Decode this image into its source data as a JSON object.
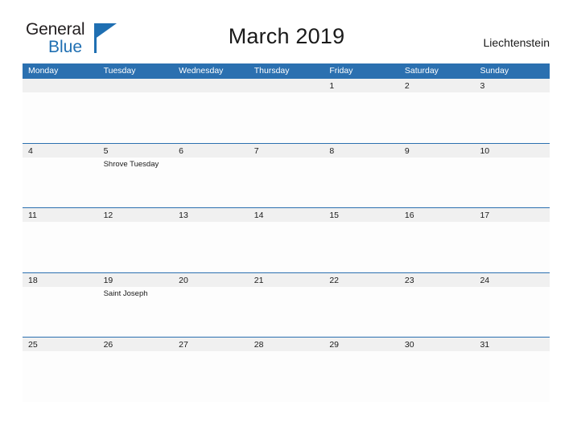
{
  "brand": {
    "name_part1": "General",
    "name_part2": "Blue",
    "triangle_icon": "triangle-icon",
    "accent_color": "#1f6fb2"
  },
  "header": {
    "title": "March 2019",
    "region": "Liechtenstein"
  },
  "calendar": {
    "header_bg": "#2b70b0",
    "band_bg": "#f0f0f0",
    "weekdays": [
      "Monday",
      "Tuesday",
      "Wednesday",
      "Thursday",
      "Friday",
      "Saturday",
      "Sunday"
    ],
    "weeks": [
      [
        {
          "num": "",
          "event": ""
        },
        {
          "num": "",
          "event": ""
        },
        {
          "num": "",
          "event": ""
        },
        {
          "num": "",
          "event": ""
        },
        {
          "num": "1",
          "event": ""
        },
        {
          "num": "2",
          "event": ""
        },
        {
          "num": "3",
          "event": ""
        }
      ],
      [
        {
          "num": "4",
          "event": ""
        },
        {
          "num": "5",
          "event": "Shrove Tuesday"
        },
        {
          "num": "6",
          "event": ""
        },
        {
          "num": "7",
          "event": ""
        },
        {
          "num": "8",
          "event": ""
        },
        {
          "num": "9",
          "event": ""
        },
        {
          "num": "10",
          "event": ""
        }
      ],
      [
        {
          "num": "11",
          "event": ""
        },
        {
          "num": "12",
          "event": ""
        },
        {
          "num": "13",
          "event": ""
        },
        {
          "num": "14",
          "event": ""
        },
        {
          "num": "15",
          "event": ""
        },
        {
          "num": "16",
          "event": ""
        },
        {
          "num": "17",
          "event": ""
        }
      ],
      [
        {
          "num": "18",
          "event": ""
        },
        {
          "num": "19",
          "event": "Saint Joseph"
        },
        {
          "num": "20",
          "event": ""
        },
        {
          "num": "21",
          "event": ""
        },
        {
          "num": "22",
          "event": ""
        },
        {
          "num": "23",
          "event": ""
        },
        {
          "num": "24",
          "event": ""
        }
      ],
      [
        {
          "num": "25",
          "event": ""
        },
        {
          "num": "26",
          "event": ""
        },
        {
          "num": "27",
          "event": ""
        },
        {
          "num": "28",
          "event": ""
        },
        {
          "num": "29",
          "event": ""
        },
        {
          "num": "30",
          "event": ""
        },
        {
          "num": "31",
          "event": ""
        }
      ]
    ]
  }
}
